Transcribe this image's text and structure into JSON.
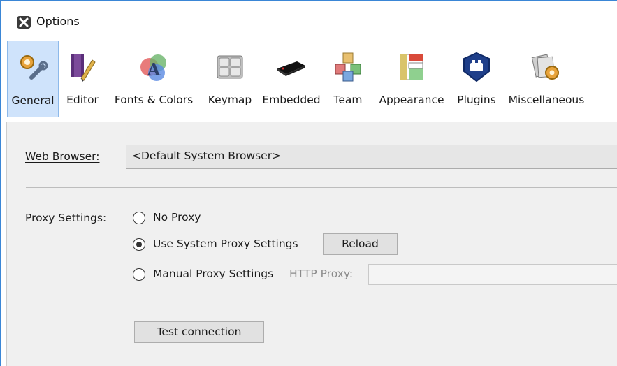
{
  "window": {
    "title": "Options",
    "icon": "netbeans-icon"
  },
  "toolbar": {
    "selected": "General",
    "items": [
      {
        "label": "General",
        "icon": "wrench-gear-icon"
      },
      {
        "label": "Editor",
        "icon": "book-pencil-icon"
      },
      {
        "label": "Fonts & Colors",
        "icon": "fonts-colors-icon"
      },
      {
        "label": "Keymap",
        "icon": "keyboard-icon"
      },
      {
        "label": "Embedded",
        "icon": "chip-icon"
      },
      {
        "label": "Team",
        "icon": "team-cubes-icon"
      },
      {
        "label": "Appearance",
        "icon": "appearance-layout-icon"
      },
      {
        "label": "Plugins",
        "icon": "plugin-icon"
      },
      {
        "label": "Miscellaneous",
        "icon": "misc-gear-icon"
      }
    ]
  },
  "general": {
    "web_browser_label": "Web Browser:",
    "web_browser_value": "<Default System Browser>",
    "proxy_label": "Proxy Settings:",
    "proxy_options": [
      {
        "label": "No Proxy",
        "selected": false
      },
      {
        "label": "Use System Proxy Settings",
        "selected": true
      },
      {
        "label": "Manual Proxy Settings",
        "selected": false
      }
    ],
    "reload_label": "Reload",
    "http_proxy_label": "HTTP Proxy:",
    "http_proxy_value": "",
    "test_connection_label": "Test connection"
  },
  "colors": {
    "selected_tab_bg": "#cfe3fb",
    "selected_tab_border": "#8db9ea",
    "panel_bg": "#f0f0f0",
    "window_border": "#3a86d6"
  }
}
